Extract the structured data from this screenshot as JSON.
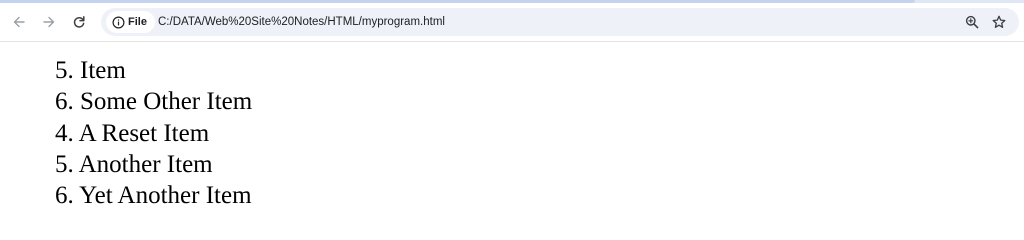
{
  "browser": {
    "site_chip_label": "File",
    "url": "C:/DATA/Web%20Site%20Notes/HTML/myprogram.html",
    "icons": {
      "back": "arrow-left-icon",
      "forward": "arrow-right-icon",
      "reload": "reload-icon",
      "info": "info-icon",
      "zoom": "zoom-icon",
      "bookmark": "star-icon"
    }
  },
  "page": {
    "list_items": [
      {
        "marker": "5.",
        "text": "Item"
      },
      {
        "marker": "6.",
        "text": "Some Other Item"
      },
      {
        "marker": "4.",
        "text": "A Reset Item"
      },
      {
        "marker": "5.",
        "text": "Another Item"
      },
      {
        "marker": "6.",
        "text": "Yet Another Item"
      }
    ]
  }
}
